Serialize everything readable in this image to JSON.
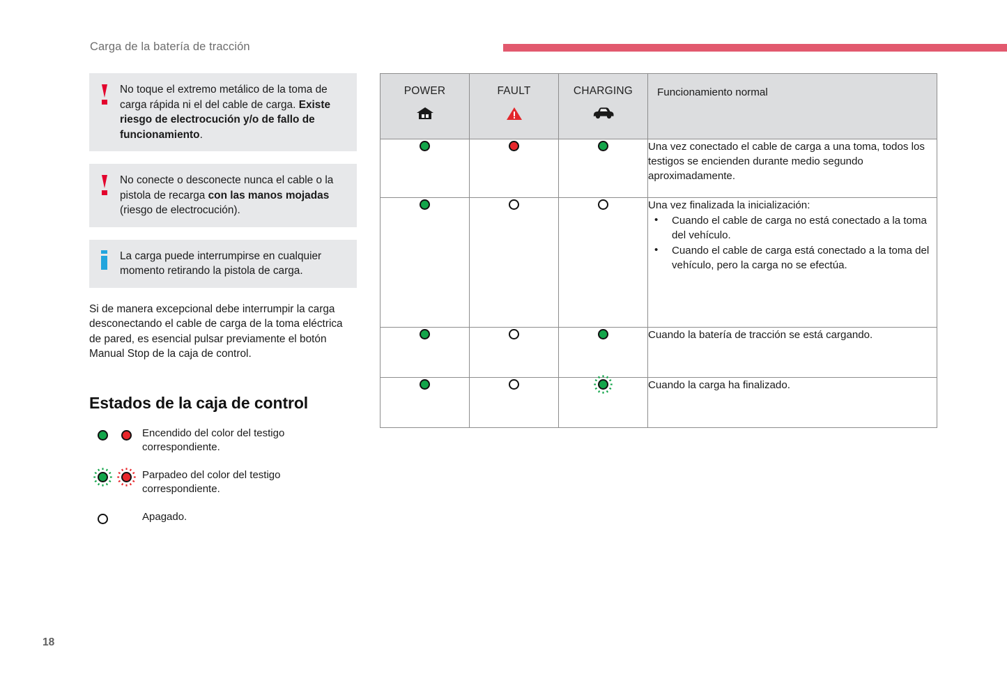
{
  "header": {
    "title": "Carga de la batería de tracción",
    "rule_color": "#e2596e"
  },
  "callouts": [
    {
      "icon": "warning-icon",
      "segments": [
        {
          "text": "No toque el extremo metálico de la toma de carga rápida ni el del cable de carga. ",
          "bold": false
        },
        {
          "text": "Existe riesgo de electrocución y/o de fallo de funcionamiento",
          "bold": true
        },
        {
          "text": ".",
          "bold": false
        }
      ]
    },
    {
      "icon": "warning-icon",
      "segments": [
        {
          "text": "No conecte o desconecte nunca el cable o la pistola de recarga ",
          "bold": false
        },
        {
          "text": "con las manos mojadas",
          "bold": true
        },
        {
          "text": " (riesgo de electrocución).",
          "bold": false
        }
      ]
    },
    {
      "icon": "info-icon",
      "segments": [
        {
          "text": "La carga puede interrumpirse en cualquier momento retirando la pistola de carga.",
          "bold": false
        }
      ]
    }
  ],
  "body_paragraph": "Si de manera excepcional debe interrumpir la carga desconectando el cable de carga de la toma eléctrica de pared, es esencial pulsar previamente el botón Manual Stop de la caja de control.",
  "section": {
    "title": "Estados de la caja de control",
    "legend": [
      {
        "icons": [
          "green-on",
          "red-on"
        ],
        "text": "Encendido del color del testigo correspondiente."
      },
      {
        "icons": [
          "green-blink",
          "red-blink"
        ],
        "text": "Parpadeo del color del testigo correspondiente."
      },
      {
        "icons": [
          "off"
        ],
        "text": "Apagado."
      }
    ]
  },
  "table": {
    "columns": [
      {
        "label": "POWER",
        "icon": "house-icon"
      },
      {
        "label": "FAULT",
        "icon": "warning-triangle-icon"
      },
      {
        "label": "CHARGING",
        "icon": "car-icon"
      }
    ],
    "header_description": "Funcionamiento normal",
    "rows": [
      {
        "power": "green-on",
        "fault": "red-on",
        "charging": "green-on",
        "description": "Una vez conectado el cable de carga a una toma, todos los testigos se encienden durante medio segundo aproximadamente.",
        "bullets": []
      },
      {
        "power": "green-on",
        "fault": "off",
        "charging": "off",
        "description": "Una vez finalizada la inicialización:",
        "bullets": [
          "Cuando el cable de carga no está conectado a la toma del vehículo.",
          "Cuando el cable de carga está conectado a la toma del vehículo, pero la carga no se efectúa."
        ]
      },
      {
        "power": "green-on",
        "fault": "off",
        "charging": "green-on",
        "description": "Cuando la batería de tracción se está cargando.",
        "bullets": []
      },
      {
        "power": "green-on",
        "fault": "off",
        "charging": "green-blink",
        "description": "Cuando la carga ha finalizado.",
        "bullets": []
      }
    ]
  },
  "footer": {
    "page_number": "18"
  },
  "colors": {
    "green": "#13a54a",
    "red": "#e8262b",
    "warning_red": "#e3032e",
    "info_blue": "#22a5dd",
    "rule": "#e2596e",
    "callout_bg": "#e7e8ea",
    "table_header_bg": "#dcdddf"
  }
}
